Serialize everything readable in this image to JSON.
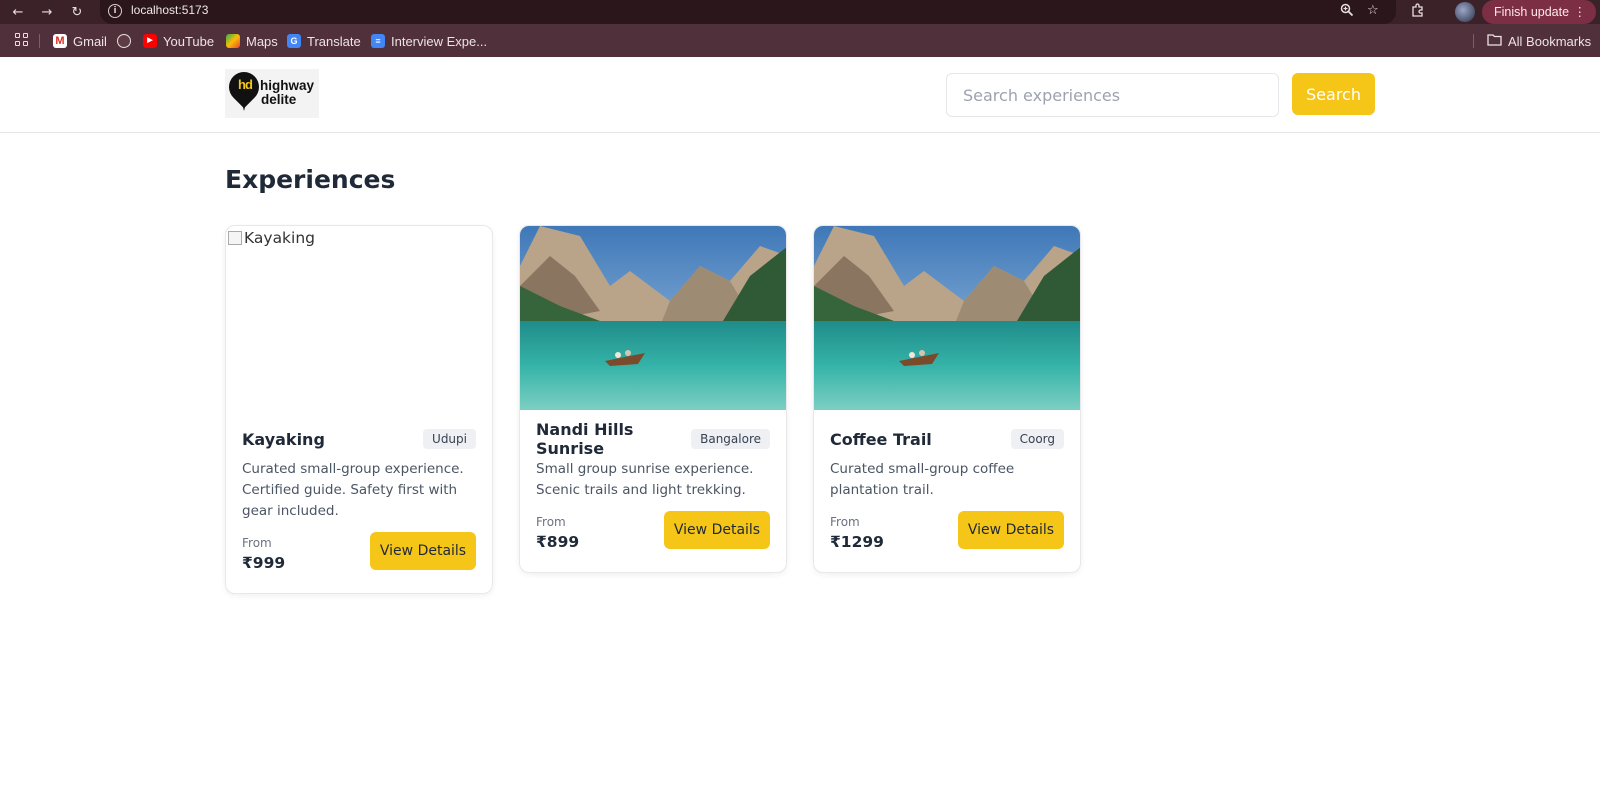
{
  "browser": {
    "url": "localhost:5173",
    "finish_update_label": "Finish update",
    "bookmarks": [
      {
        "label": "Gmail"
      },
      {
        "label": ""
      },
      {
        "label": "YouTube"
      },
      {
        "label": "Maps"
      },
      {
        "label": "Translate"
      },
      {
        "label": "Interview Expe..."
      }
    ],
    "all_bookmarks_label": "All Bookmarks"
  },
  "header": {
    "logo_text_line1": "highway",
    "logo_text_line2": "delite",
    "logo_mark": "hd",
    "search_placeholder": "Search experiences",
    "search_button": "Search"
  },
  "main": {
    "title": "Experiences",
    "cards": [
      {
        "title": "Kayaking",
        "location": "Udupi",
        "description": "Curated small-group experience. Certified guide. Safety first with gear included.",
        "from_label": "From",
        "price": "₹999",
        "button": "View Details",
        "image_alt": "Kayaking",
        "image_broken": true
      },
      {
        "title": "Nandi Hills Sunrise",
        "location": "Bangalore",
        "description": "Small group sunrise experience. Scenic trails and light trekking.",
        "from_label": "From",
        "price": "₹899",
        "button": "View Details",
        "image_broken": false
      },
      {
        "title": "Coffee Trail",
        "location": "Coorg",
        "description": "Curated small-group coffee plantation trail.",
        "from_label": "From",
        "price": "₹1299",
        "button": "View Details",
        "image_broken": false
      }
    ]
  },
  "colors": {
    "accent": "#f5c518",
    "chrome_dark": "#3b2229",
    "bookmarks_bar": "#50303a"
  }
}
